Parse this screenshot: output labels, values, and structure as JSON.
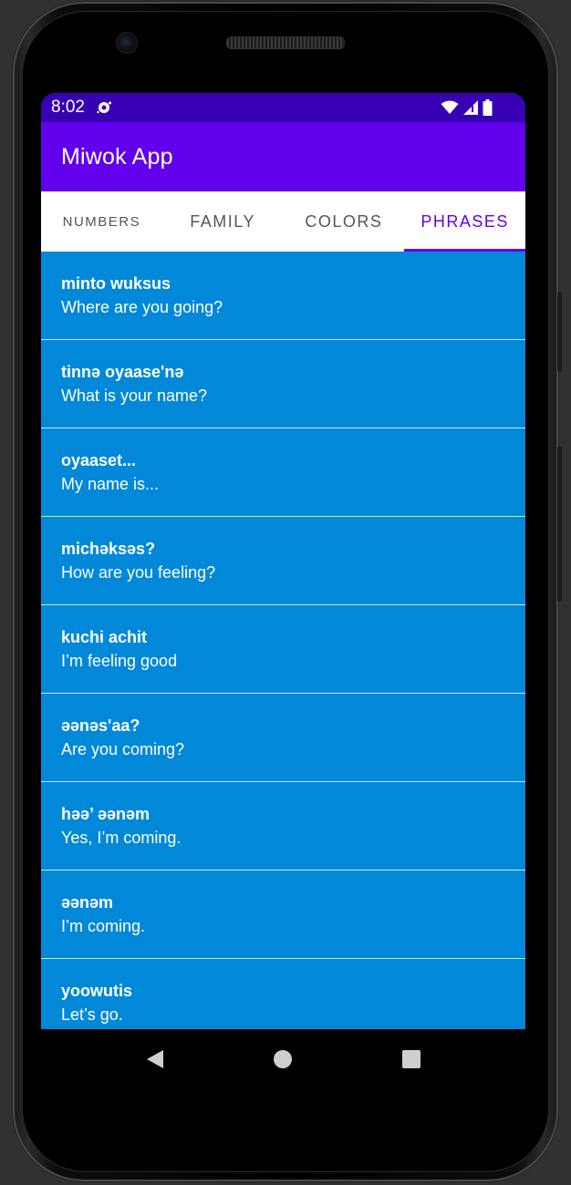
{
  "status_bar": {
    "time": "8:02",
    "icons": [
      "notification-icon",
      "wifi-icon",
      "signal-icon",
      "battery-icon"
    ]
  },
  "app_bar": {
    "title": "Miwok App"
  },
  "tabs": [
    {
      "label": "NUMBERS",
      "active": false
    },
    {
      "label": "FAMILY",
      "active": false
    },
    {
      "label": "COLORS",
      "active": false
    },
    {
      "label": "PHRASES",
      "active": true
    }
  ],
  "phrases": [
    {
      "miwok": "minto wuksus",
      "default": "Where are you going?"
    },
    {
      "miwok": "tinnə oyaase'nə",
      "default": "What is your name?"
    },
    {
      "miwok": "oyaaset...",
      "default": "My name is..."
    },
    {
      "miwok": "michəksəs?",
      "default": "How are you feeling?"
    },
    {
      "miwok": "kuchi achit",
      "default": "I’m feeling good"
    },
    {
      "miwok": "əənəs'aa?",
      "default": "Are you coming?"
    },
    {
      "miwok": "həə’ əənəm",
      "default": "Yes, I’m coming."
    },
    {
      "miwok": "əənəm",
      "default": "I’m coming."
    },
    {
      "miwok": "yoowutis",
      "default": "Let’s go."
    }
  ],
  "nav_bar": {
    "icons": [
      "back-icon",
      "home-icon",
      "recents-icon"
    ]
  },
  "colors": {
    "status_bar": "#3700b3",
    "app_bar": "#6200ee",
    "list_background": "#0288d9",
    "tab_active": "#6200ee"
  }
}
